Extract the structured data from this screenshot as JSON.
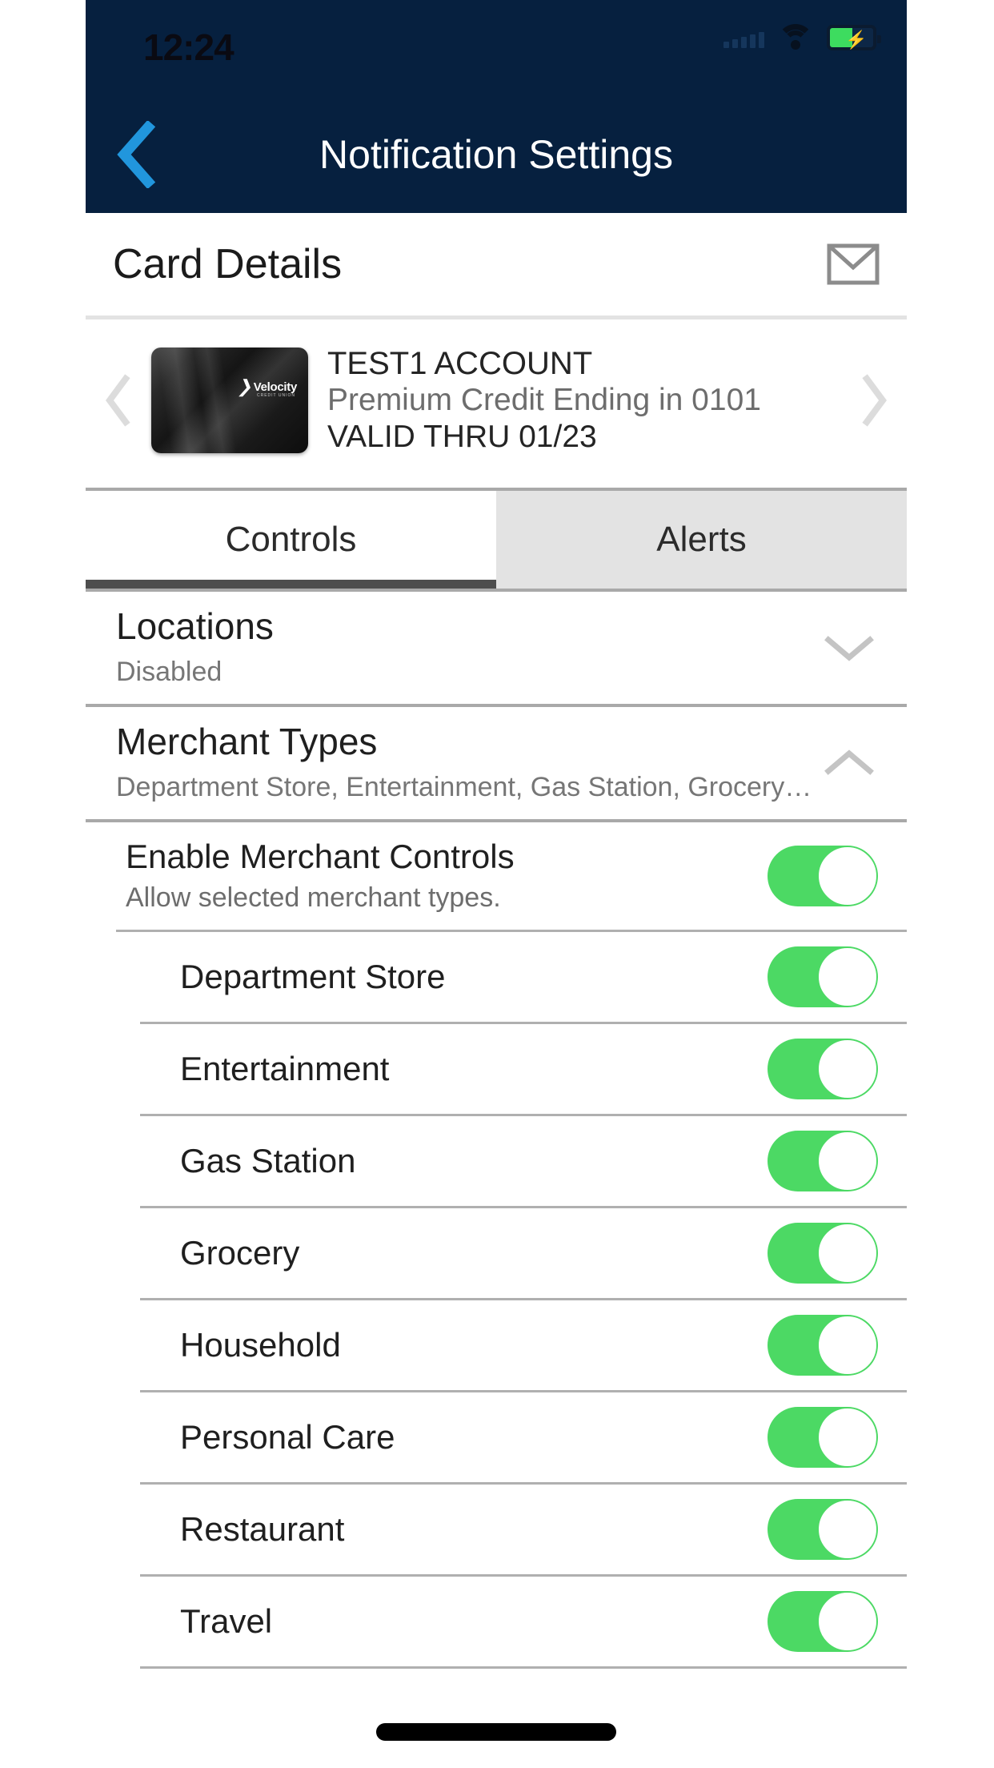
{
  "statusbar": {
    "time": "12:24",
    "signal_icon": "signal-bars-icon",
    "wifi_icon": "wifi-icon",
    "battery_icon": "battery-charging-icon"
  },
  "navbar": {
    "back_icon": "chevron-left-icon",
    "title": "Notification Settings"
  },
  "card_details": {
    "header_title": "Card Details",
    "mail_icon": "envelope-icon",
    "prev_icon": "chevron-left-icon",
    "next_icon": "chevron-right-icon",
    "card_brand": "Velocity",
    "card_brand_sub": "CREDIT UNION",
    "account_name": "TEST1 ACCOUNT",
    "card_description": "Premium Credit Ending in 0101",
    "valid_thru": "VALID THRU 01/23"
  },
  "tabs": [
    {
      "label": "Controls",
      "active": true
    },
    {
      "label": "Alerts",
      "active": false
    }
  ],
  "sections": [
    {
      "title": "Locations",
      "subtitle": "Disabled",
      "expanded": false,
      "chevron_icon": "chevron-down-icon"
    },
    {
      "title": "Merchant Types",
      "subtitle": "Department Store, Entertainment, Gas Station, Grocery…",
      "expanded": true,
      "chevron_icon": "chevron-up-icon"
    }
  ],
  "enable_control": {
    "title": "Enable Merchant Controls",
    "subtitle": "Allow selected merchant types.",
    "toggle_on": true
  },
  "merchant_types": [
    {
      "label": "Department Store",
      "toggle_on": true
    },
    {
      "label": "Entertainment",
      "toggle_on": true
    },
    {
      "label": "Gas Station",
      "toggle_on": true
    },
    {
      "label": "Grocery",
      "toggle_on": true
    },
    {
      "label": "Household",
      "toggle_on": true
    },
    {
      "label": "Personal Care",
      "toggle_on": true
    },
    {
      "label": "Restaurant",
      "toggle_on": true
    },
    {
      "label": "Travel",
      "toggle_on": true
    }
  ],
  "colors": {
    "navbar_bg": "#06203f",
    "back_chevron": "#2196dd",
    "toggle_on": "#4cd964",
    "tab_active_underline": "#4d4d4d",
    "tab_inactive_bg": "#e3e3e3",
    "battery_fill": "#3ddc5f"
  }
}
